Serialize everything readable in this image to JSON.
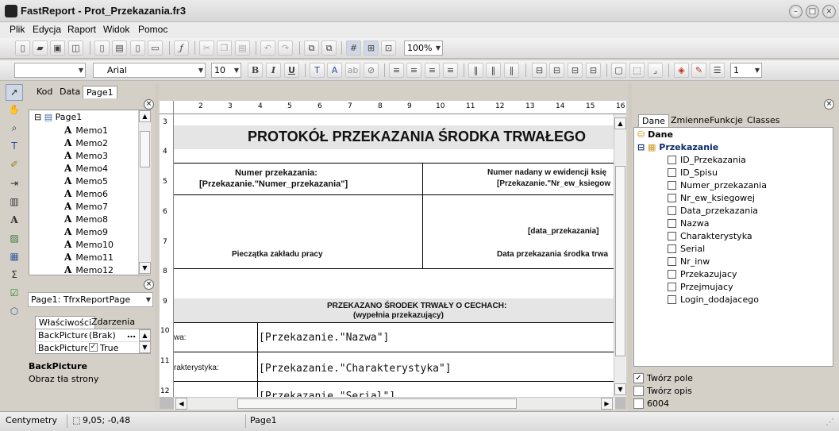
{
  "window": {
    "title": "FastReport - Prot_Przekazania.fr3"
  },
  "menu": [
    "Plik",
    "Edycja",
    "Raport",
    "Widok",
    "Pomoc"
  ],
  "toolbar1": {
    "zoom": "100%"
  },
  "toolbar2": {
    "font_name": "Arial",
    "font_size": "10",
    "bold": "B",
    "italic": "I",
    "underline": "U",
    "frame_width": "1"
  },
  "tabs": {
    "code": "Kod",
    "data": "Data",
    "page": "Page1"
  },
  "tree": {
    "root": "Page1",
    "items": [
      "Memo1",
      "Memo2",
      "Memo3",
      "Memo4",
      "Memo5",
      "Memo6",
      "Memo7",
      "Memo8",
      "Memo9",
      "Memo10",
      "Memo11",
      "Memo12"
    ]
  },
  "object_inspector": {
    "selected": "Page1: TfrxReportPage",
    "tab_properties": "Właściwości",
    "tab_events": "Zdarzenia",
    "rows": [
      {
        "name": "BackPicture",
        "value": "(Brak)"
      },
      {
        "name": "BackPicturePrintable",
        "value": "True"
      }
    ],
    "help_title": "BackPicture",
    "help_text": "Obraz tła strony"
  },
  "ruler": {
    "h": [
      "2",
      "3",
      "4",
      "5",
      "6",
      "7",
      "8",
      "9",
      "10",
      "11",
      "12",
      "13",
      "14",
      "15",
      "16"
    ],
    "v": [
      "3",
      "4",
      "5",
      "6",
      "7",
      "8",
      "9",
      "10",
      "11",
      "12"
    ]
  },
  "report": {
    "title": "PROTOKÓŁ PRZEKAZANIA ŚRODKA TRWAŁEGO",
    "num_label": "Numer przekazania:",
    "num_field": "[Przekazanie.\"Numer_przekazania\"]",
    "ewid_label": "Numer nadany w ewidencji księ",
    "ewid_field": "[Przekazanie.\"Nr_ew_ksiegow",
    "stamp_label": "Pieczątka zakładu pracy",
    "date_field": "[data_przekazania]",
    "date_label": "Data przekazania środka trwa",
    "section_title": "PRZEKAZANO  ŚRODEK TRWAŁY O CECHACH:",
    "section_sub": "(wypełnia przekazujący)",
    "row1_label": "wa:",
    "row1_field": "[Przekazanie.\"Nazwa\"]",
    "row2_label": "rakterystyka:",
    "row2_field": "[Przekazanie.\"Charakterystyka\"]",
    "row3_field": "[Przekazanie.\"Serial\"]"
  },
  "data_panel": {
    "tabs": [
      "Dane",
      "Zmienne",
      "Funkcje",
      "Classes"
    ],
    "root": "Dane",
    "dataset": "Przekazanie",
    "fields": [
      "ID_Przekazania",
      "ID_Spisu",
      "Numer_przekazania",
      "Nr_ew_ksiegowej",
      "Data_przekazania",
      "Nazwa",
      "Charakterystyka",
      "Serial",
      "Nr_inw",
      "Przekazujacy",
      "Przejmujacy",
      "Login_dodajacego"
    ]
  },
  "options": [
    {
      "label": "Twórz pole",
      "checked": true
    },
    {
      "label": "Twórz opis",
      "checked": false
    },
    {
      "label": "6004",
      "checked": false
    }
  ],
  "status": {
    "units": "Centymetry",
    "coords": "9,05; -0,48",
    "page": "Page1"
  }
}
